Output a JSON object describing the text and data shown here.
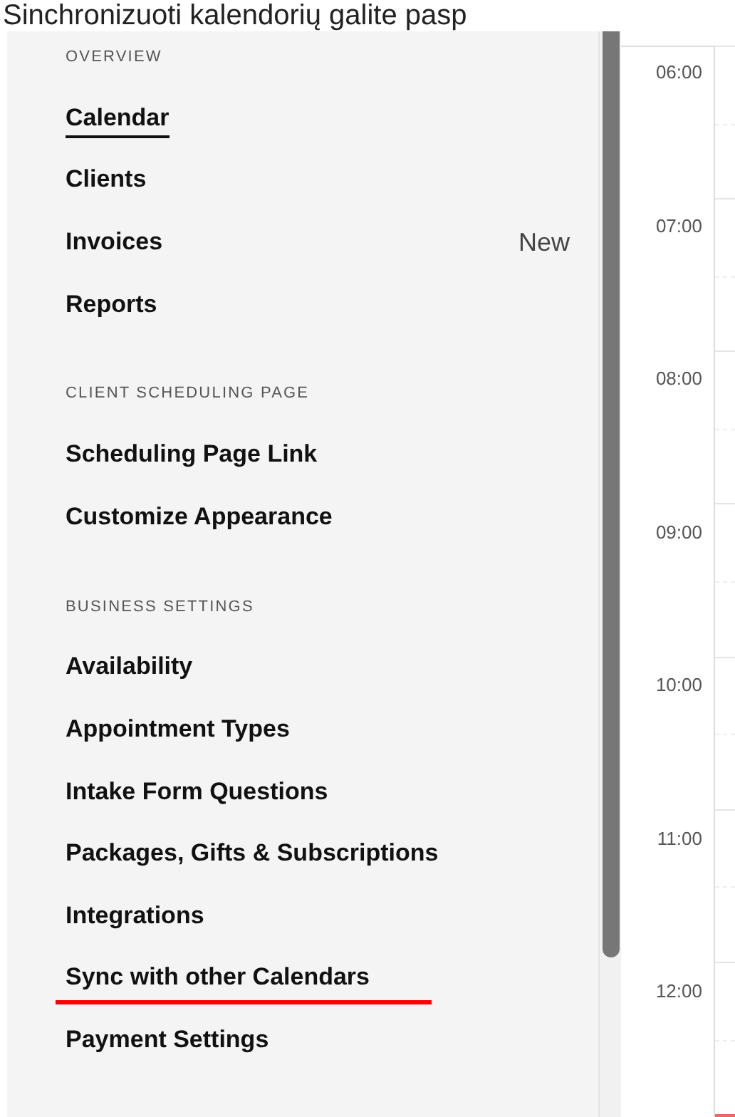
{
  "caption": "Sinchronizuoti kalendorių galite pasp",
  "sections": [
    {
      "header": "OVERVIEW",
      "items": [
        {
          "label": "Calendar",
          "selected": true,
          "annotated": false
        },
        {
          "label": "Clients",
          "selected": false,
          "annotated": false
        },
        {
          "label": "Invoices",
          "selected": false,
          "annotated": false,
          "badge": "New"
        },
        {
          "label": "Reports",
          "selected": false,
          "annotated": false
        }
      ]
    },
    {
      "header": "CLIENT SCHEDULING PAGE",
      "items": [
        {
          "label": "Scheduling Page Link",
          "selected": false,
          "annotated": false
        },
        {
          "label": "Customize Appearance",
          "selected": false,
          "annotated": false
        }
      ]
    },
    {
      "header": "BUSINESS SETTINGS",
      "items": [
        {
          "label": "Availability",
          "selected": false,
          "annotated": false
        },
        {
          "label": "Appointment Types",
          "selected": false,
          "annotated": false
        },
        {
          "label": "Intake Form Questions",
          "selected": false,
          "annotated": false
        },
        {
          "label": "Packages, Gifts & Subscriptions",
          "selected": false,
          "annotated": false
        },
        {
          "label": "Integrations",
          "selected": false,
          "annotated": false
        },
        {
          "label": "Sync with other Calendars",
          "selected": false,
          "annotated": true
        },
        {
          "label": "Payment Settings",
          "selected": false,
          "annotated": false
        }
      ]
    }
  ],
  "hours": [
    "06:00",
    "07:00",
    "08:00",
    "09:00",
    "10:00",
    "11:00",
    "12:00"
  ]
}
